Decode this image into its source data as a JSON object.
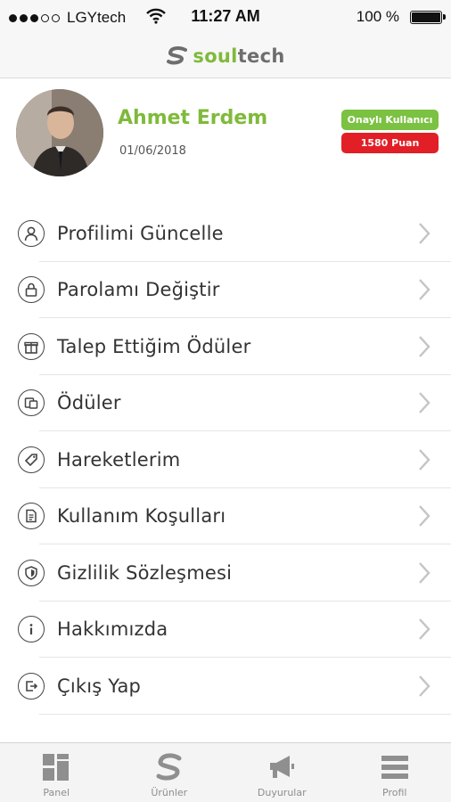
{
  "status_bar": {
    "carrier": "LGYtech",
    "time": "11:27 AM",
    "battery": "100 %"
  },
  "header": {
    "brand_soul": "soul",
    "brand_tech": "tech"
  },
  "profile": {
    "name": "Ahmet Erdem",
    "date": "01/06/2018",
    "badge_approved": "Onaylı Kullanıcı",
    "badge_points": "1580 Puan"
  },
  "menu": {
    "items": [
      {
        "label": "Profilimi Güncelle",
        "icon": "user-icon"
      },
      {
        "label": "Parolamı Değiştir",
        "icon": "lock-icon"
      },
      {
        "label": "Talep Ettiğim Ödüler",
        "icon": "gift-icon"
      },
      {
        "label": "Ödüler",
        "icon": "rewards-icon"
      },
      {
        "label": "Hareketlerim",
        "icon": "tag-icon"
      },
      {
        "label": "Kullanım Koşulları",
        "icon": "document-icon"
      },
      {
        "label": "Gizlilik Sözleşmesi",
        "icon": "shield-icon"
      },
      {
        "label": "Hakkımızda",
        "icon": "info-icon"
      },
      {
        "label": "Çıkış Yap",
        "icon": "logout-icon"
      }
    ]
  },
  "tab_bar": {
    "tabs": [
      {
        "label": "Panel",
        "icon": "panel-icon"
      },
      {
        "label": "Ürünler",
        "icon": "products-icon"
      },
      {
        "label": "Duyurular",
        "icon": "megaphone-icon"
      },
      {
        "label": "Profil",
        "icon": "menu-icon"
      }
    ]
  },
  "colors": {
    "brand_green": "#7fba3a",
    "points_red": "#e21f26",
    "approved_green": "#7bc142"
  }
}
